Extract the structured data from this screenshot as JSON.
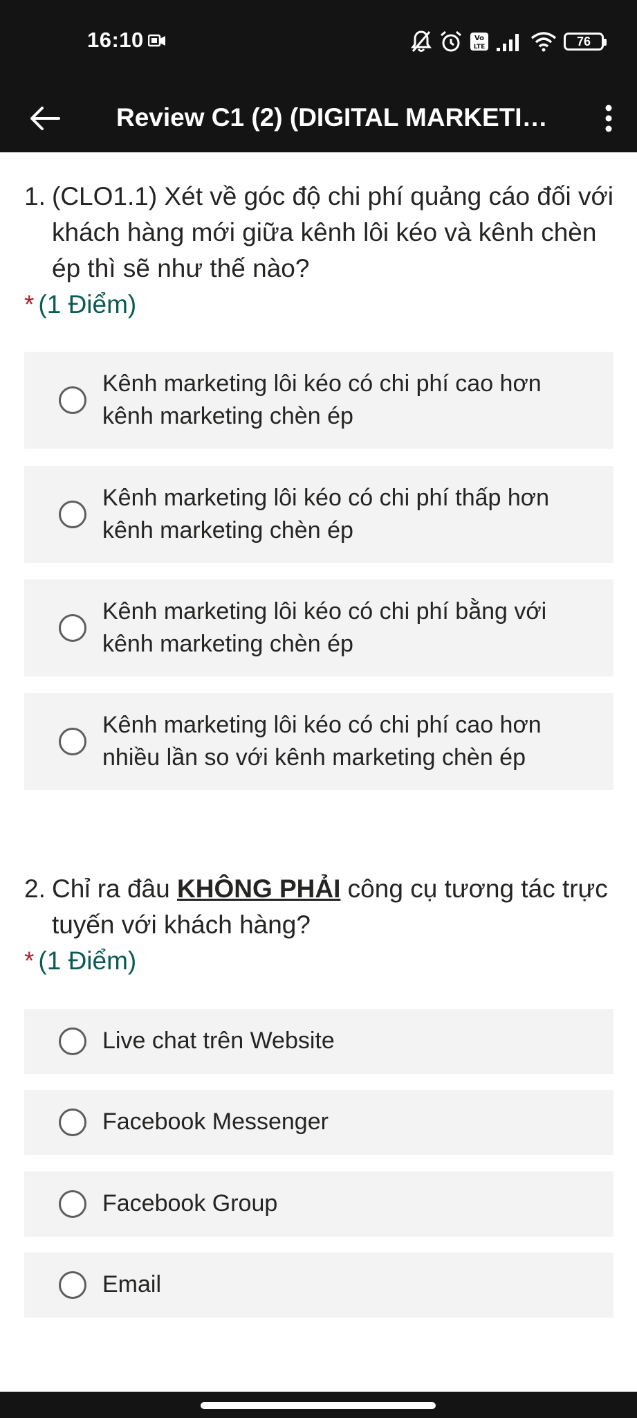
{
  "status_bar": {
    "time": "16:10",
    "battery": "76",
    "icons": [
      "bell-off-icon",
      "alarm-icon",
      "volte-icon",
      "signal-icon",
      "wifi-icon",
      "battery-icon"
    ]
  },
  "app_bar": {
    "title": "Review C1 (2) (DIGITAL MARKETIN...",
    "back_icon": "arrow-left-icon",
    "menu_icon": "more-vertical-icon"
  },
  "questions": [
    {
      "number": "1.",
      "text": "(CLO1.1) Xét về góc độ chi phí quảng cáo đối với khách hàng mới giữa kênh lôi kéo và kênh chèn ép thì sẽ như thế nào?",
      "required_mark": "*",
      "points": "(1 Điểm)",
      "options": [
        "Kênh marketing lôi kéo có chi phí cao hơn kênh marketing chèn ép",
        "Kênh marketing lôi kéo có chi phí thấp hơn kênh marketing chèn ép",
        "Kênh marketing lôi kéo có chi phí bằng với kênh marketing chèn ép",
        "Kênh marketing lôi kéo có chi phí cao hơn nhiều lần so với kênh marketing chèn ép"
      ]
    },
    {
      "number": "2.",
      "text_before": "Chỉ ra đâu ",
      "text_emphasis": "KHÔNG PHẢI",
      "text_after": " công cụ tương tác trực tuyến với khách hàng?",
      "required_mark": "*",
      "points": "(1 Điểm)",
      "options": [
        "Live chat trên Website",
        "Facebook Messenger",
        "Facebook Group",
        "Email"
      ]
    }
  ],
  "colors": {
    "bar_background": "#141414",
    "option_background": "#f3f3f3",
    "points_color": "#0b5a55",
    "required_color": "#a4262c"
  }
}
